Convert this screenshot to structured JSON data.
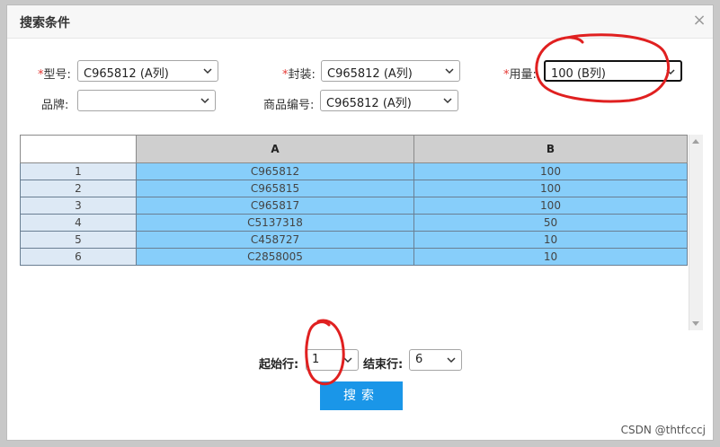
{
  "dialog": {
    "title": "搜索条件",
    "close_glyph": "×"
  },
  "form": {
    "model": {
      "label": "型号:",
      "value": "C965812 (A列)"
    },
    "package": {
      "label": "封装:",
      "value": "C965812 (A列)"
    },
    "quantity": {
      "label": "用量:",
      "value": "100 (B列)"
    },
    "brand": {
      "label": "品牌:",
      "value": ""
    },
    "product_code": {
      "label": "商品编号:",
      "value": "C965812 (A列)"
    },
    "required_mark": "*"
  },
  "grid": {
    "columns": [
      "",
      "A",
      "B"
    ],
    "rows": [
      [
        "1",
        "C965812",
        "100"
      ],
      [
        "2",
        "C965815",
        "100"
      ],
      [
        "3",
        "C965817",
        "100"
      ],
      [
        "4",
        "C5137318",
        "50"
      ],
      [
        "5",
        "C458727",
        "10"
      ],
      [
        "6",
        "C2858005",
        "10"
      ]
    ]
  },
  "range": {
    "start_label": "起始行:",
    "start_value": "1",
    "end_label": "结束行:",
    "end_value": "6"
  },
  "search_button": "搜索",
  "watermark": "CSDN @thtfcccj",
  "colors": {
    "header_cell": "#cfcfcf",
    "row_head": "#dde9f5",
    "data_cell": "#87cefa",
    "button": "#1a96e8",
    "required": "#e53935",
    "annotation": "#e02020"
  }
}
